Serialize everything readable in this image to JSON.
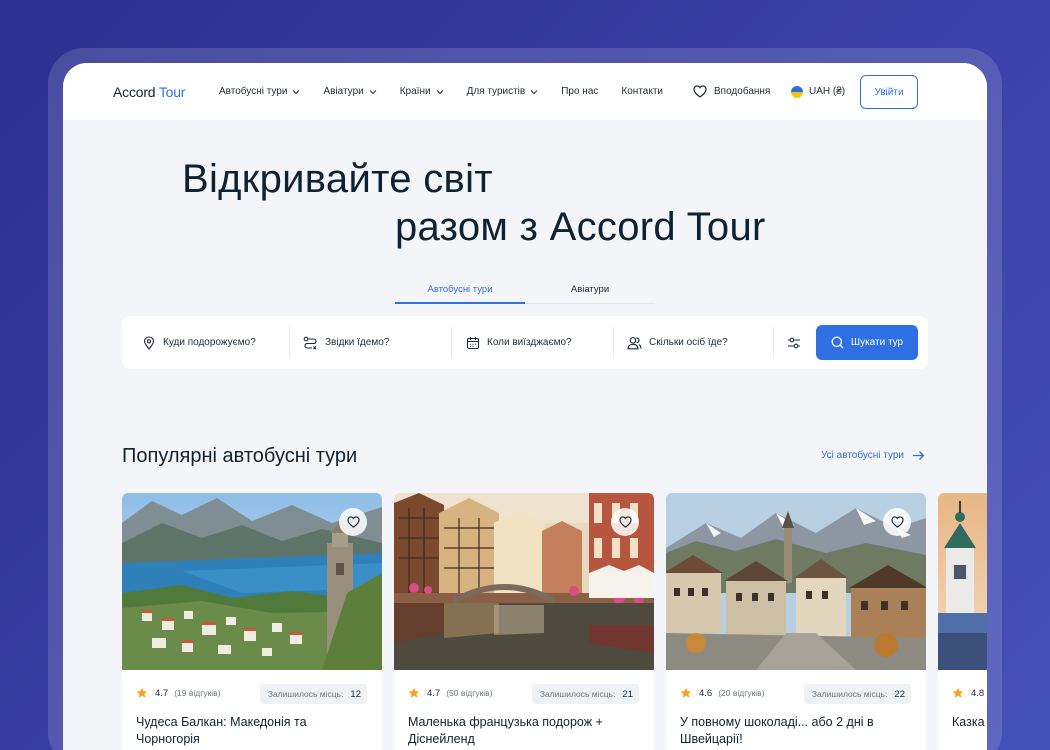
{
  "header": {
    "logo_main": "Accord",
    "logo_accent": "Tour",
    "nav": [
      {
        "label": "Автобусні тури",
        "dropdown": true
      },
      {
        "label": "Авіатури",
        "dropdown": true
      },
      {
        "label": "Країни",
        "dropdown": true
      },
      {
        "label": "Для туристів",
        "dropdown": true
      },
      {
        "label": "Про нас",
        "dropdown": false
      },
      {
        "label": "Контакти",
        "dropdown": false
      }
    ],
    "favorites_label": "Вподобання",
    "currency_label": "UAH (₴)",
    "login_label": "Увійти"
  },
  "hero": {
    "line1": "Відкривайте світ",
    "line2": "разом з Accord Tour"
  },
  "tabs": [
    {
      "label": "Автобусні тури",
      "active": true
    },
    {
      "label": "Авіатури",
      "active": false
    }
  ],
  "search": {
    "destination_placeholder": "Куди подорожуємо?",
    "origin_placeholder": "Звідки їдемо?",
    "date_placeholder": "Коли виїзджаємо?",
    "people_placeholder": "Скільки осіб їде?",
    "button_label": "Шукати тур"
  },
  "section": {
    "title": "Популярні автобусні тури",
    "all_link": "Усі автобусні тури"
  },
  "cards": [
    {
      "rating": "4.7",
      "reviews": "(19 відгуків)",
      "seats_label": "Залишилось місць:",
      "seats": "12",
      "title": "Чудеса Балкан: Македонія та Чорногорія"
    },
    {
      "rating": "4.7",
      "reviews": "(50 відгуків)",
      "seats_label": "Залишилось місць:",
      "seats": "21",
      "title": "Маленька французька подорож + Діснейленд"
    },
    {
      "rating": "4.6",
      "reviews": "(20 відгуків)",
      "seats_label": "Залишилось місць:",
      "seats": "22",
      "title": "У повному шоколаді... або 2 дні в Швейцарії!"
    },
    {
      "rating": "4.8",
      "title": "Казка та Ві"
    }
  ],
  "colors": {
    "accent": "#2f6fe4",
    "text": "#0f2233",
    "star": "#f5a623",
    "background_gradient": "#2b2f8f"
  }
}
